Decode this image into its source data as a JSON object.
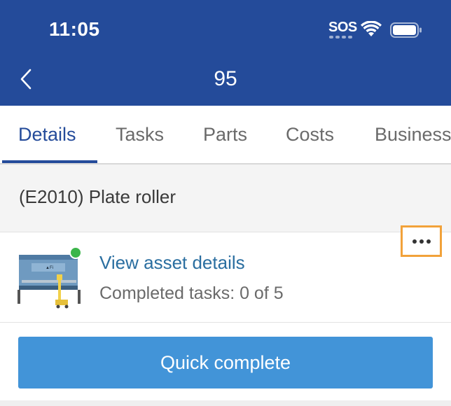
{
  "status_bar": {
    "time": "11:05",
    "sos_label": "SOS",
    "icons": [
      "wifi-icon",
      "battery-icon"
    ]
  },
  "nav": {
    "back_icon": "chevron-left-icon",
    "title": "95"
  },
  "tabs": [
    {
      "label": "Details",
      "active": true
    },
    {
      "label": "Tasks",
      "active": false
    },
    {
      "label": "Parts",
      "active": false
    },
    {
      "label": "Costs",
      "active": false
    },
    {
      "label": "Business",
      "active": false
    }
  ],
  "section": {
    "title": "(E2010) Plate roller"
  },
  "asset": {
    "link_label": "View asset details",
    "completed_tasks": "Completed tasks: 0 of 5",
    "status_color": "#3bb54a",
    "more_icon": "more-horizontal-icon"
  },
  "actions": {
    "quick_complete_label": "Quick complete"
  },
  "colors": {
    "header": "#244b9a",
    "link": "#2a6ea0",
    "button": "#4294d8",
    "highlight": "#f2a23a"
  }
}
